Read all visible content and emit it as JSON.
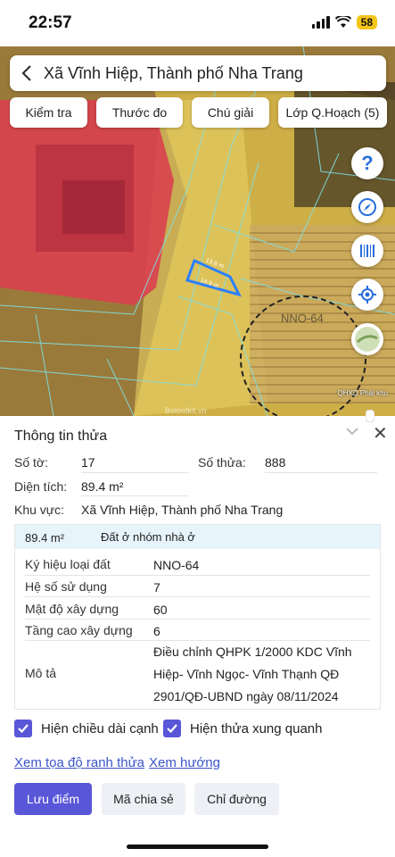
{
  "status": {
    "time": "22:57",
    "battery": "58"
  },
  "header": {
    "title": "Xã Vĩnh Hiệp, Thành phố Nha Trang"
  },
  "map_buttons": [
    "Kiểm tra",
    "Thước đo",
    "Chú giải",
    "Lớp Q.Hoạch (5)"
  ],
  "map": {
    "dimension_top": "13.6 m",
    "dimension_bottom": "14.9 m",
    "zone_label": "NNO-64",
    "credit": "QHXD Phái khu",
    "watermark": "Botoolkit.vn"
  },
  "panel": {
    "title": "Thông tin thửa",
    "so_to_label": "Số tờ:",
    "so_to_value": "17",
    "so_thua_label": "Số thửa:",
    "so_thua_value": "888",
    "dien_tich_label": "Diện tích:",
    "dien_tich_value": "89.4 m²",
    "khu_vuc_label": "Khu vực:",
    "khu_vuc_value": "Xã Vĩnh Hiệp, Thành phố Nha Trang"
  },
  "zone": {
    "area": "89.4 m²",
    "type": "Đất ở nhóm nhà ở",
    "rows": [
      {
        "label": "Ký hiệu loại đất",
        "value": "NNO-64"
      },
      {
        "label": "Hệ số sử dụng",
        "value": "7"
      },
      {
        "label": "Mật độ xây dựng",
        "value": "60"
      },
      {
        "label": "Tầng cao xây dựng",
        "value": "6"
      }
    ],
    "desc_label": "Mô tả",
    "desc_value": "Điều chỉnh QHPK 1/2000 KDC Vĩnh Hiệp- Vĩnh Ngọc- Vĩnh Thạnh QĐ 2901/QĐ-UBND ngày 08/11/2024"
  },
  "checkboxes": {
    "edge_length": "Hiện chiều dài cạnh",
    "surrounding": "Hiện thửa xung quanh"
  },
  "links": {
    "coords": "Xem tọa độ ranh thửa",
    "direction": "Xem hướng"
  },
  "actions": {
    "save": "Lưu điểm",
    "share": "Mã chia sẻ",
    "route": "Chỉ đường"
  },
  "colors": {
    "accent": "#5956d8",
    "link": "#3b55c9",
    "highlight": "#e7f4fb",
    "red_zone": "#d9404f",
    "yellow_zone": "#e8c84a"
  }
}
